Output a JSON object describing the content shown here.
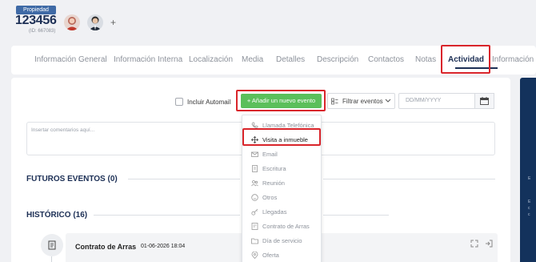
{
  "header": {
    "badge": "Propiedad",
    "ref": "123456",
    "sub_id": "(ID: 667083)",
    "add_icon": "+"
  },
  "tabs": [
    {
      "label": "Información General"
    },
    {
      "label": "Información Interna"
    },
    {
      "label": "Localización"
    },
    {
      "label": "Media"
    },
    {
      "label": "Detalles"
    },
    {
      "label": "Descripción"
    },
    {
      "label": "Contactos"
    },
    {
      "label": "Notas"
    },
    {
      "label": "Actividad",
      "active": true
    },
    {
      "label": "Información"
    }
  ],
  "toolbar": {
    "include_automail": "Incluir Automail",
    "add_event": "Añadir un nuevo evento",
    "add_event_icon": "+",
    "filter_events": "Filtrar eventos",
    "date_placeholder": "DD/MM/YYYY"
  },
  "comment_placeholder": "Insertar comentarios aquí...",
  "sections": {
    "future": "FUTUROS EVENTOS (0)",
    "history": "HISTÓRICO (16)"
  },
  "event": {
    "title": "Contrato de Arras",
    "date": "01-06-2026 18:04"
  },
  "event_menu": [
    {
      "label": "Llamada Telefónica",
      "icon": "phone-icon"
    },
    {
      "label": "Visita a inmueble",
      "icon": "move-icon",
      "selected": true
    },
    {
      "label": "Email",
      "icon": "email-icon"
    },
    {
      "label": "Escritura",
      "icon": "document-icon"
    },
    {
      "label": "Reunión",
      "icon": "people-icon"
    },
    {
      "label": "Otros",
      "icon": "smile-icon"
    },
    {
      "label": "Llegadas",
      "icon": "key-icon"
    },
    {
      "label": "Contrato de Arras",
      "icon": "contract-icon"
    },
    {
      "label": "Día de servicio",
      "icon": "folder-icon"
    },
    {
      "label": "Oferta",
      "icon": "location-icon"
    }
  ],
  "colors": {
    "brand": "#1c2f55",
    "accent_green": "#5bbf5b",
    "highlight": "#d9252b",
    "badge": "#3f6aa6"
  }
}
